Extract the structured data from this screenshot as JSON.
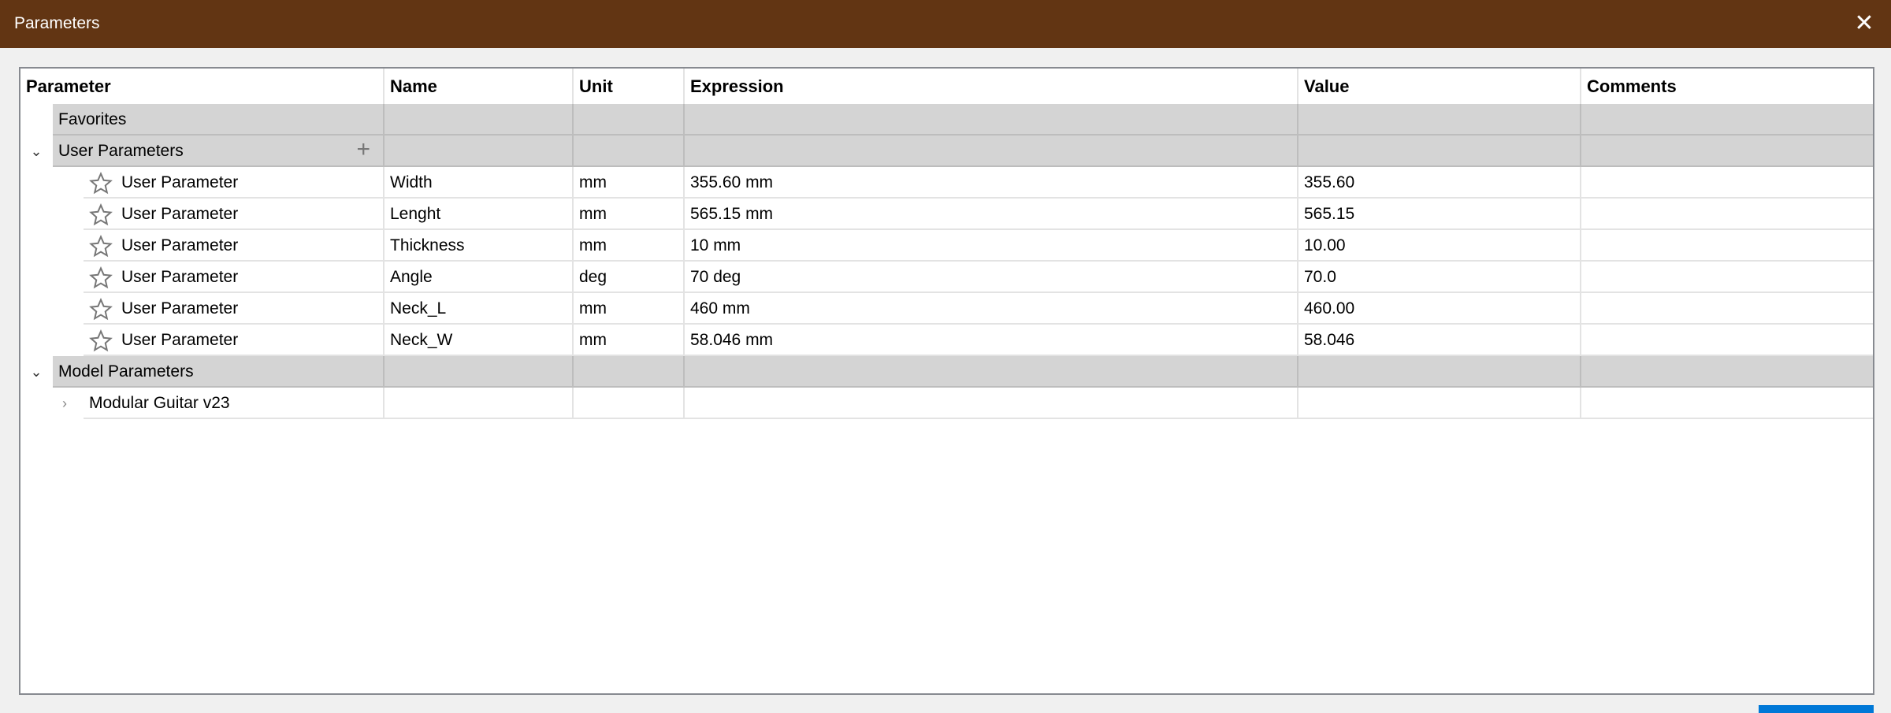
{
  "window": {
    "title": "Parameters",
    "close_icon": "close-icon"
  },
  "columns": [
    "Parameter",
    "Name",
    "Unit",
    "Expression",
    "Value",
    "Comments"
  ],
  "groups": {
    "favorites": "Favorites",
    "user": "User Parameters",
    "model": "Model Parameters"
  },
  "user_parameters": [
    {
      "parameter": "User Parameter",
      "name": "Width",
      "unit": "mm",
      "expression": "355.60 mm",
      "value": "355.60",
      "comments": ""
    },
    {
      "parameter": "User Parameter",
      "name": "Lenght",
      "unit": "mm",
      "expression": "565.15 mm",
      "value": "565.15",
      "comments": ""
    },
    {
      "parameter": "User Parameter",
      "name": "Thickness",
      "unit": "mm",
      "expression": "10 mm",
      "value": "10.00",
      "comments": ""
    },
    {
      "parameter": "User Parameter",
      "name": "Angle",
      "unit": "deg",
      "expression": "70 deg",
      "value": "70.0",
      "comments": ""
    },
    {
      "parameter": "User Parameter",
      "name": "Neck_L",
      "unit": "mm",
      "expression": "460 mm",
      "value": "460.00",
      "comments": ""
    },
    {
      "parameter": "User Parameter",
      "name": "Neck_W",
      "unit": "mm",
      "expression": "58.046 mm",
      "value": "58.046",
      "comments": ""
    }
  ],
  "model_items": [
    {
      "label": "Modular Guitar v23"
    }
  ],
  "colors": {
    "titlebar": "#623513",
    "group_bg": "#d4d4d4",
    "accent": "#0078d7"
  }
}
